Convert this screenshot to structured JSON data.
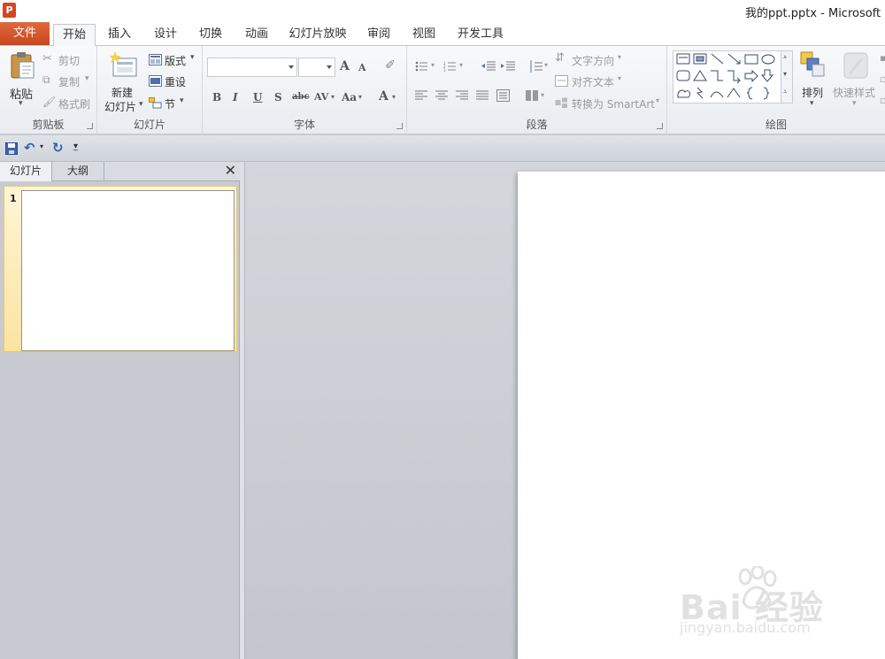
{
  "window": {
    "app_icon_letter": "P",
    "title": "我的ppt.pptx  -  Microsoft Po"
  },
  "tabs": {
    "file": "文件",
    "items": [
      "开始",
      "插入",
      "设计",
      "切换",
      "动画",
      "幻灯片放映",
      "审阅",
      "视图",
      "开发工具"
    ],
    "active": "开始"
  },
  "ribbon": {
    "clipboard": {
      "label": "剪贴板",
      "paste": "粘贴",
      "cut": "剪切",
      "copy": "复制",
      "format_painter": "格式刷"
    },
    "slides": {
      "label": "幻灯片",
      "new_slide_line1": "新建",
      "new_slide_line2": "幻灯片",
      "layout": "版式",
      "reset": "重设",
      "section": "节"
    },
    "font": {
      "label": "字体",
      "font_name": "",
      "font_size": "",
      "bold": "B",
      "italic": "I",
      "underline": "U",
      "strike": "S",
      "abc": "abc",
      "spacing": "AV",
      "case": "Aa",
      "grow": "A",
      "shrink": "A",
      "color": "A"
    },
    "paragraph": {
      "label": "段落",
      "text_direction": "文字方向",
      "align_text": "对齐文本",
      "convert_smartart": "转换为 SmartArt"
    },
    "drawing": {
      "label": "绘图",
      "arrange": "排列",
      "quick_styles": "快速样式"
    }
  },
  "quick_access": {
    "icons": [
      "save-icon",
      "undo-icon",
      "redo-icon",
      "customize-icon"
    ]
  },
  "left_pane": {
    "tabs": [
      "幻灯片",
      "大纲"
    ],
    "active_tab": "幻灯片",
    "close": "✕",
    "slides": [
      {
        "number": "1"
      }
    ]
  },
  "watermark": {
    "main": "Bai 经验",
    "sub": "jingyan.baidu.com"
  },
  "colors": {
    "file_tab": "#d24726",
    "ribbon_bg": "#f4f5f7",
    "selected_thumb": "#fbe3a1",
    "workspace_bg": "#c9cdd3"
  }
}
